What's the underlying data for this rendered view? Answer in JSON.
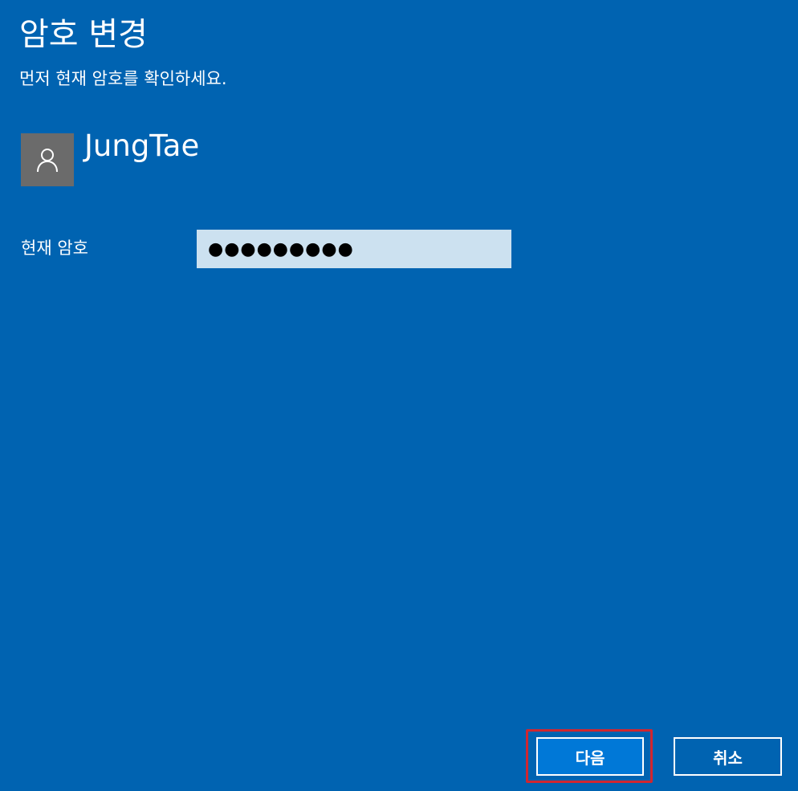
{
  "dialog": {
    "title": "암호 변경",
    "subtitle": "먼저 현재 암호를 확인하세요."
  },
  "user": {
    "name": "JungTae",
    "avatar_icon": "person-icon"
  },
  "form": {
    "current_password_label": "현재 암호",
    "current_password_value": "●●●●●●●●●"
  },
  "buttons": {
    "next_label": "다음",
    "cancel_label": "취소"
  },
  "colors": {
    "background": "#0063b1",
    "input_background": "#cce1f0",
    "primary_button": "#0078d7",
    "avatar_background": "#6b6b6b",
    "focus_highlight": "#d1262f"
  }
}
